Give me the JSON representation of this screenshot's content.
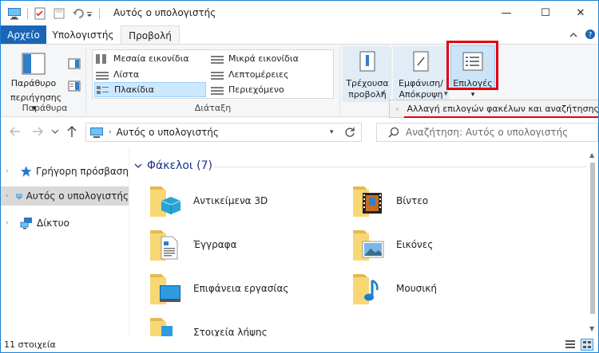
{
  "window": {
    "title": "Αυτός ο υπολογιστής",
    "minimize_glyph": "—",
    "maximize_glyph": "☐",
    "close_glyph": "✕"
  },
  "tabs": [
    {
      "label": "Αρχείο"
    },
    {
      "label": "Υπολογιστής"
    },
    {
      "label": "Προβολή"
    }
  ],
  "ribbon": {
    "panes": {
      "button_label_1": "Παράθυρο",
      "button_label_2": "περιήγησης",
      "group_label": "Παράθυρα"
    },
    "layout": {
      "group_label": "Διάταξη",
      "options": [
        {
          "label": "Μεσαία εικονίδια"
        },
        {
          "label": "Μικρά εικονίδια"
        },
        {
          "label": "Λίστα"
        },
        {
          "label": "Λεπτομέρειες"
        },
        {
          "label": "Πλακίδια"
        },
        {
          "label": "Περιεχόμενο"
        }
      ],
      "selected": "Πλακίδια"
    },
    "current_view": {
      "label_1": "Τρέχουσα",
      "label_2": "προβολή"
    },
    "show_hide": {
      "label_1": "Εμφάνιση/",
      "label_2": "Απόκρυψη"
    },
    "options": {
      "label": "Επιλογές"
    },
    "options_menu_item": "Αλλαγή επιλογών φακέλων και αναζήτησης"
  },
  "navigation": {
    "address": "Αυτός ο υπολογιστής",
    "search_placeholder": "Αναζήτηση: Αυτός ο υπολογιστής"
  },
  "nav_pane": {
    "items": [
      {
        "label": "Γρήγορη πρόσβαση"
      },
      {
        "label": "Αυτός ο υπολογιστής"
      },
      {
        "label": "Δίκτυο"
      }
    ]
  },
  "content": {
    "section_title": "Φάκελοι (7)",
    "folders": [
      {
        "label": "Αντικείμενα 3D"
      },
      {
        "label": "Βίντεο"
      },
      {
        "label": "Έγγραφα"
      },
      {
        "label": "Εικόνες"
      },
      {
        "label": "Επιφάνεια εργασίας"
      },
      {
        "label": "Μουσική"
      },
      {
        "label": "Στοιχεία λήψης"
      }
    ]
  },
  "status": {
    "item_count": "11 στοιχεία"
  },
  "colors": {
    "accent": "#1a66b5",
    "highlight_red": "#e1000f",
    "folder_yellow": "#f8d775"
  }
}
